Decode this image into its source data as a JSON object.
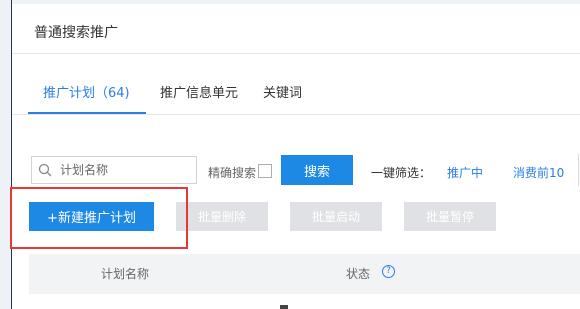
{
  "panel": {
    "title": "普通搜索推广"
  },
  "tabs": [
    {
      "label": "推广计划（64)",
      "active": true
    },
    {
      "label": "推广信息单元",
      "active": false
    },
    {
      "label": "关键词",
      "active": false
    }
  ],
  "search": {
    "placeholder": "计划名称",
    "value": ""
  },
  "exact_search": {
    "label": "精确搜索",
    "checked": false
  },
  "search_button": {
    "label": "搜索"
  },
  "quick_filter": {
    "label": "一键筛选：",
    "options": [
      "推广中",
      "消费前10"
    ]
  },
  "actions": {
    "new_plan": "+新建推广计划",
    "batch_delete": "批量删除",
    "batch_enable": "批量启动",
    "batch_pause": "批量暂停"
  },
  "table": {
    "columns": [
      "计划名称",
      "状态"
    ],
    "help_glyph": "?"
  },
  "colors": {
    "accent": "#1e88e5",
    "link": "#2b7de9",
    "highlight": "#e53935",
    "disabled_button": "#e0e1e4"
  }
}
